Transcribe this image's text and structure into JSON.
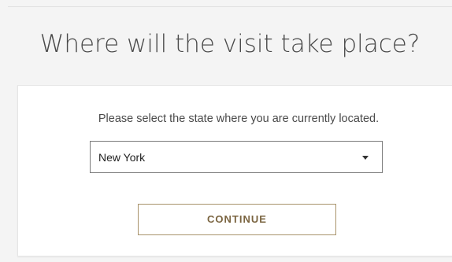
{
  "page": {
    "title": "Where will the visit take place?"
  },
  "location_form": {
    "prompt": "Please select the state where you are currently located.",
    "state_select": {
      "selected_value": "New York",
      "icon": "chevron-down-icon"
    },
    "continue_label": "CONTINUE"
  },
  "colors": {
    "background": "#f4f4f4",
    "card": "#ffffff",
    "button_border": "#a8926a",
    "button_text": "#7a6440",
    "text": "#4a4a4a"
  }
}
